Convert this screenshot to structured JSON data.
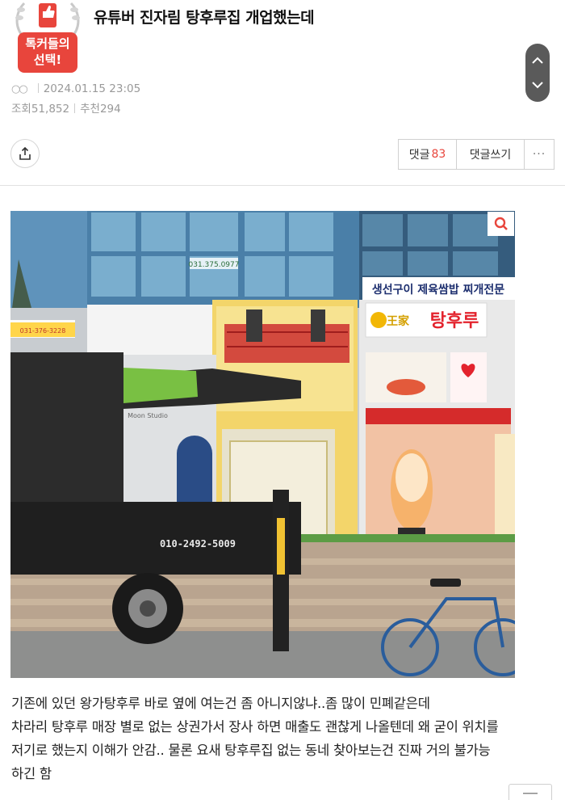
{
  "badge": {
    "line1": "톡커들의",
    "line2": "선택!",
    "icon": "thumbs-up-icon"
  },
  "post": {
    "title": "유튜버 진자림 탕후루집 개업했는데",
    "author_icon": "user-icon",
    "datetime": "2024.01.15 23:05",
    "views_label": "조회",
    "views": "51,852",
    "recommend_label": "추천",
    "recommend": "294"
  },
  "toolbar": {
    "share_icon": "share-icon",
    "comments_label": "댓글",
    "comments_count": "83",
    "write_comment_label": "댓글쓰기",
    "more_label": "···"
  },
  "scroll": {
    "up_icon": "chevron-up-icon",
    "down_icon": "chevron-down-icon"
  },
  "photo": {
    "zoom_icon": "search-icon",
    "signs": {
      "upper_right": "생선구이 제육쌈밥 찌개전문",
      "shop_brand": "王家",
      "shop_name": "탕후루",
      "truck_phone": "010-2492-5009",
      "left_phone": "031-376-3228",
      "glass_phone": "031.375.0977",
      "studio": "Moon Studio"
    }
  },
  "body": {
    "lines": [
      "기존에 있던 왕가탕후루 바로 옆에 여는건 좀 아니지않냐..좀 많이 민폐같은데",
      "차라리 탕후루 매장 별로 없는 상권가서 장사 하면 매출도 괜찮게 나올텐데 왜 굳이 위치를",
      "저기로 했는지 이해가 안감.. 물론 요새 탕후루집 없는 동네 찾아보는건 진짜 거의 불가능",
      "하긴 함"
    ]
  },
  "colors": {
    "accent": "#e8453c",
    "muted": "#999999",
    "truck_green": "#7bc043"
  }
}
